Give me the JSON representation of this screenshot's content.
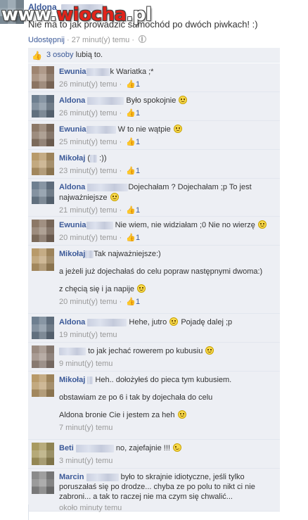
{
  "watermark": {
    "prefix": "www.",
    "brand": "wiocha",
    "suffix": ".pl"
  },
  "post": {
    "author": "Aldona",
    "text": "Nie ma to jak prowadzić samochód po dwóch piwkach! :)",
    "share_label": "Udostępnij",
    "separator": " · ",
    "time": "27 minut(y) temu",
    "time_sep": " · "
  },
  "likes": {
    "count_link": "3 osoby",
    "suffix": " lubią to."
  },
  "comments": [
    {
      "name": "Ewunia",
      "lines": [
        "k Wariatka ;*"
      ],
      "time": "26 minut(y) temu",
      "likes": "1"
    },
    {
      "name": "Aldona",
      "lines": [
        "Było spokojnie"
      ],
      "time": "26 minut(y) temu",
      "likes": "1"
    },
    {
      "name": "Ewunia",
      "lines": [
        "W to nie wątpie"
      ],
      "time": "25 minut(y) temu",
      "likes": "1"
    },
    {
      "name": "Mikołaj",
      "lines": [
        ":))"
      ],
      "time": "23 minut(y) temu",
      "likes": "1"
    },
    {
      "name": "Aldona",
      "lines": [
        "Dojechałam ? Dojechałam ;p To jest",
        "najważniejsze"
      ],
      "time": "21 minut(y) temu",
      "likes": "1"
    },
    {
      "name": "Ewunia",
      "lines": [
        "Nie wiem, nie widziałam ;0 Nie no wierzę"
      ],
      "time": "20 minut(y) temu",
      "likes": "1"
    },
    {
      "name": "Mikołaj",
      "lines": [
        "Tak najważniejsze:)",
        "a jeżeli już dojechałaś do celu popraw następnymi dwoma:)",
        "z chęcią się i ja napije"
      ],
      "time": "20 minut(y) temu",
      "likes": "1"
    },
    {
      "name": "Aldona",
      "lines": [
        "Hehe, jutro",
        "Pojadę dalej ;p"
      ],
      "time": "19 minut(y) temu",
      "likes": ""
    },
    {
      "name": "",
      "lines": [
        "to jak jechać rowerem po kubusiu"
      ],
      "time": "9 minut(y) temu",
      "likes": ""
    },
    {
      "name": "Mikołaj",
      "lines": [
        "Heh.. dołożyłeś do pieca tym kubusiem.",
        "obstawiam ze po 6 i tak by dojechała do celu",
        "Aldona bronie Cie i jestem za heh"
      ],
      "time": "7 minut(y) temu",
      "likes": ""
    },
    {
      "name": "Beti",
      "lines": [
        "no, zajefajnie !!!"
      ],
      "time": "3 minut(y) temu",
      "likes": ""
    },
    {
      "name": "Marcin",
      "lines": [
        "było to skrajnie idiotyczne, jeśli tylko",
        "poruszałaś się po drodze... chyba ze po polu to nikt ci nie",
        "zabroni... a tak to raczej nie ma czym się chwalić..."
      ],
      "time": "około minuty temu",
      "likes": ""
    }
  ],
  "icons": {
    "like": "thumbs-up-icon",
    "audience": "globe-icon",
    "emoticon": "smiley-icon"
  },
  "colors": {
    "link": "#3b5998",
    "comment_bg": "#edeff4",
    "meta": "#999999",
    "watermark_red": "#e2231a"
  }
}
